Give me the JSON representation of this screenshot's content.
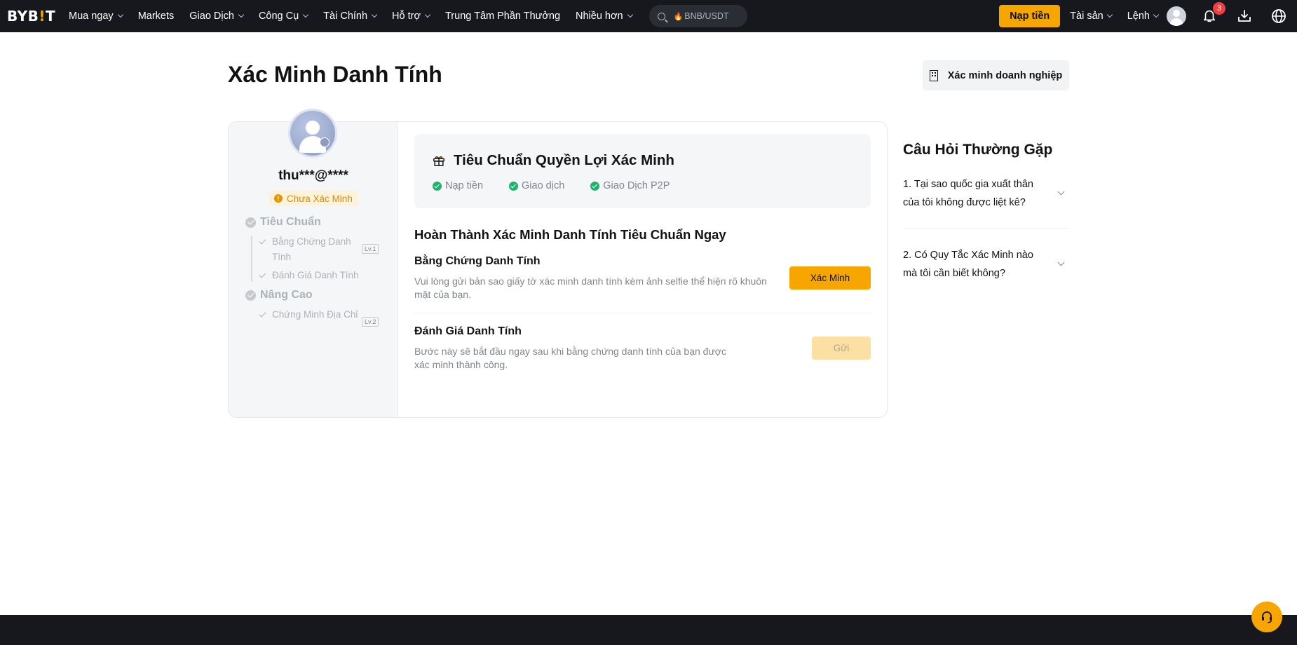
{
  "topbar": {
    "logo_main": "BYB",
    "logo_accent": "!",
    "logo_tail": "T",
    "nav": [
      {
        "label": "Mua ngay",
        "has_dropdown": true
      },
      {
        "label": "Markets",
        "has_dropdown": false
      },
      {
        "label": "Giao Dịch",
        "has_dropdown": true
      },
      {
        "label": "Công Cụ",
        "has_dropdown": true
      },
      {
        "label": "Tài Chính",
        "has_dropdown": true
      },
      {
        "label": "Hỗ trợ",
        "has_dropdown": true
      },
      {
        "label": "Trung Tâm Phần Thưởng",
        "has_dropdown": false
      },
      {
        "label": "Nhiều hơn",
        "has_dropdown": true
      }
    ],
    "search_placeholder": "BNB/USDT",
    "deposit_label": "Nạp tiền",
    "assets_label": "Tài sản",
    "orders_label": "Lệnh",
    "notification_count": "3",
    "accent_color": "#f7a600"
  },
  "page": {
    "title": "Xác Minh Danh Tính",
    "business_button": "Xác minh doanh nghiệp"
  },
  "profile": {
    "email": "thu***@****",
    "status": "Chưa Xác Minh",
    "status_mark": "!"
  },
  "steps": {
    "standard_label": "Tiêu Chuẩn",
    "standard_items": [
      {
        "label": "Bằng Chứng Danh Tính",
        "level": "Lv.1"
      },
      {
        "label": "Đánh Giá Danh Tính",
        "level": ""
      }
    ],
    "advanced_label": "Nâng Cao",
    "advanced_items": [
      {
        "label": "Chứng Minh Địa Chỉ",
        "level": "Lv.2"
      }
    ]
  },
  "benefits": {
    "title": "Tiêu Chuẩn Quyền Lợi Xác Minh",
    "items": [
      "Nạp tiền",
      "Giao dịch",
      "Giao Dịch P2P"
    ]
  },
  "main": {
    "section_title": "Hoàn Thành Xác Minh Danh Tính Tiêu Chuẩn Ngay",
    "rows": [
      {
        "title": "Bằng Chứng Danh Tính",
        "desc": "Vui lòng gửi bản sao giấy tờ xác minh danh tính kèm ảnh selfie thể hiện rõ khuôn mặt của bạn.",
        "button": "Xác Minh"
      },
      {
        "title": "Đánh Giá Danh Tính",
        "desc": "Bước này sẽ bắt đầu ngay sau khi bằng chứng danh tính của bạn được xác minh thành công.",
        "button": "Gửi"
      }
    ]
  },
  "faq": {
    "title": "Câu Hỏi Thường Gặp",
    "items": [
      "1. Tại sao quốc gia xuất thân của tôi không được liệt kê?",
      "2. Có Quy Tắc Xác Minh nào mà tôi cần biết không?"
    ]
  }
}
